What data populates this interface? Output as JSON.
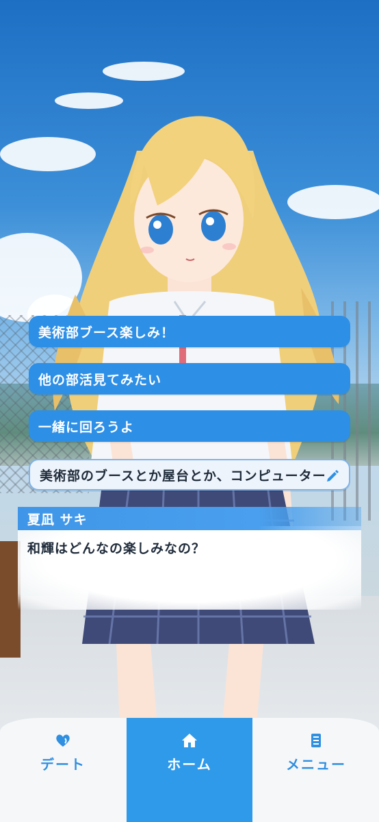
{
  "choices": [
    {
      "label": "美術部ブース楽しみ！"
    },
    {
      "label": "他の部活見てみたい"
    },
    {
      "label": "一緒に回ろうよ"
    }
  ],
  "input_choice": {
    "label": "美術部のブースとか屋台とか、コンピューター",
    "icon": "pencil-icon"
  },
  "dialog": {
    "speaker": "夏凪 サキ",
    "text": "和輝はどんなの楽しみなの？"
  },
  "nav": {
    "items": [
      {
        "label": "デート",
        "icon": "heart-icon"
      },
      {
        "label": "ホーム",
        "icon": "home-icon",
        "active": true
      },
      {
        "label": "メニュー",
        "icon": "menu-doc-icon"
      }
    ]
  },
  "colors": {
    "accent": "#2f9ae9",
    "choice_bg": "#2d8fe6",
    "name_tag": "#3f96e8"
  }
}
